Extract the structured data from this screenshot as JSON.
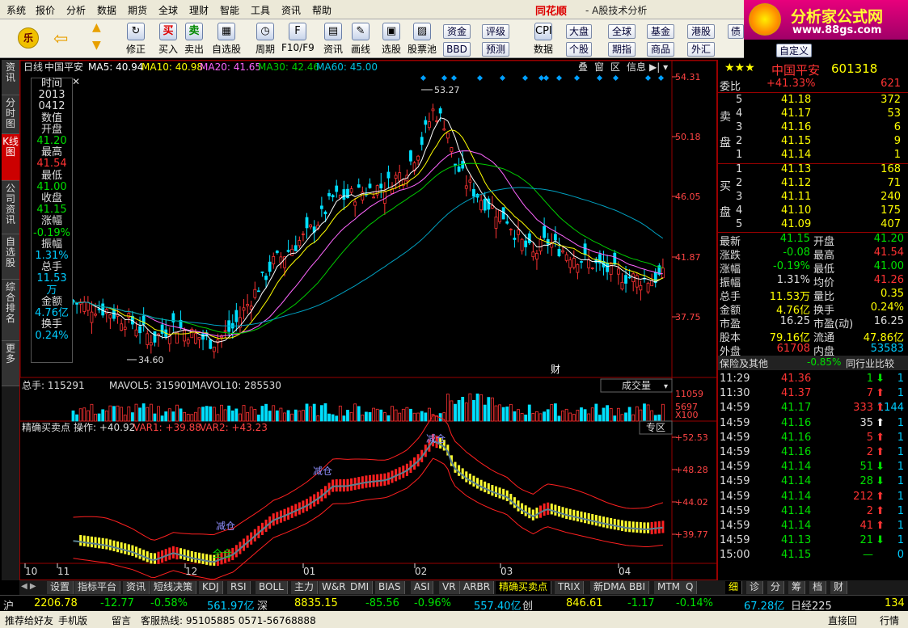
{
  "menu": [
    "系统",
    "报价",
    "分析",
    "数据",
    "期货",
    "全球",
    "理财",
    "智能",
    "工具",
    "资讯",
    "帮助"
  ],
  "brand": "同花顺",
  "window_title": "- A股技术分析",
  "logo": {
    "text": "分析家公式网",
    "url": "www.88gs.com"
  },
  "toolbar": {
    "items": [
      "修正",
      "买入",
      "卖出",
      "自选股",
      "周期",
      "F10/F9",
      "资讯",
      "画线",
      "选股",
      "股票池",
      "数据"
    ],
    "small": [
      "资金",
      "评级",
      "BBD",
      "预测",
      "大盘",
      "全球",
      "基金",
      "港股",
      "债",
      "个股",
      "期指",
      "商品",
      "外汇",
      "自定义"
    ]
  },
  "left_tabs": [
    "资讯",
    "分时图",
    "K线图",
    "公司资讯",
    "自选股",
    "综合排名",
    "更多"
  ],
  "kline": {
    "label": "日线",
    "stock": "中国平安",
    "ma5": "MA5: 40.94",
    "ma10": "MA10: 40.98",
    "ma20": "MA20: 41.65",
    "ma30": "MA30: 42.46",
    "ma60": "MA60: 45.00",
    "tools": [
      "叠",
      "窗",
      "区",
      "信息"
    ],
    "price_ticks": [
      "54.31",
      "50.18",
      "46.05",
      "41.87",
      "37.75"
    ],
    "high_label": "53.27",
    "low_label": "34.60",
    "cai_label": "财"
  },
  "infobox": [
    [
      "时间",
      "w"
    ],
    [
      "2013",
      "w"
    ],
    [
      "0412",
      "w"
    ],
    [
      "数值",
      "w"
    ],
    [
      "开盘",
      "w"
    ],
    [
      "41.20",
      "g"
    ],
    [
      "最高",
      "w"
    ],
    [
      "41.54",
      "r"
    ],
    [
      "最低",
      "w"
    ],
    [
      "41.00",
      "g"
    ],
    [
      "收盘",
      "w"
    ],
    [
      "41.15",
      "g"
    ],
    [
      "涨幅",
      "w"
    ],
    [
      "-0.19%",
      "g"
    ],
    [
      "振幅",
      "w"
    ],
    [
      "1.31%",
      "c"
    ],
    [
      "总手",
      "w"
    ],
    [
      "11.53万",
      "c"
    ],
    [
      "金额",
      "w"
    ],
    [
      "4.76亿",
      "c"
    ],
    [
      "换手",
      "w"
    ],
    [
      "0.24%",
      "c"
    ]
  ],
  "volume": {
    "title": "总手: 115291",
    "mavol5": "MAVOL5: 315901",
    "mavol10": "MAVOL10: 285530",
    "selector": "成交量",
    "ticks": [
      "11059",
      "5697",
      "X100"
    ]
  },
  "indicator": {
    "title": "精确买卖点",
    "op": "操作: +40.92",
    "var1": "VAR1: +39.88",
    "var2": "VAR2: +43.23",
    "zone": "专区",
    "ticks": [
      "+52.53",
      "+48.28",
      "+44.02",
      "+39.77"
    ],
    "labels": [
      "减仓",
      "减仓",
      "减仓",
      "全仓"
    ]
  },
  "xaxis": [
    "10",
    "11",
    "12",
    "01",
    "02",
    "03",
    "04"
  ],
  "quote": {
    "name": "中国平安",
    "code": "601318",
    "weibi_label": "委比",
    "weibi": "+41.33%",
    "weicha": "621",
    "sell": [
      [
        "5",
        "41.18",
        "372"
      ],
      [
        "4",
        "41.17",
        "53"
      ],
      [
        "3",
        "41.16",
        "6"
      ],
      [
        "2",
        "41.15",
        "9"
      ],
      [
        "1",
        "41.14",
        "1"
      ]
    ],
    "buy": [
      [
        "1",
        "41.13",
        "168"
      ],
      [
        "2",
        "41.12",
        "71"
      ],
      [
        "3",
        "41.11",
        "240"
      ],
      [
        "4",
        "41.10",
        "175"
      ],
      [
        "5",
        "41.09",
        "407"
      ]
    ],
    "sell_label": [
      "卖",
      "盘"
    ],
    "buy_label": [
      "买",
      "盘"
    ],
    "stats": [
      [
        "最新",
        "41.15",
        "g",
        "开盘",
        "41.20",
        "g"
      ],
      [
        "涨跌",
        "-0.08",
        "g",
        "最高",
        "41.54",
        "r"
      ],
      [
        "涨幅",
        "-0.19%",
        "g",
        "最低",
        "41.00",
        "g"
      ],
      [
        "振幅",
        "1.31%",
        "w",
        "均价",
        "41.26",
        "r"
      ],
      [
        "总手",
        "11.53万",
        "y",
        "量比",
        "0.35",
        "y"
      ],
      [
        "金额",
        "4.76亿",
        "y",
        "换手",
        "0.24%",
        "y"
      ],
      [
        "市盈",
        "16.25",
        "w",
        "市盈(动)",
        "16.25",
        "w"
      ],
      [
        "股本",
        "79.16亿",
        "y",
        "流通",
        "47.86亿",
        "y"
      ],
      [
        "外盘",
        "61708",
        "r",
        "内盘",
        "53583",
        "c"
      ]
    ],
    "sector": "保险及其他",
    "sector_chg": "-0.85%",
    "peer": "同行业比较",
    "ticks": [
      [
        "11:29",
        "41.36",
        "r",
        "1",
        "g",
        "1"
      ],
      [
        "11:30",
        "41.37",
        "r",
        "7",
        "r",
        "1"
      ],
      [
        "14:59",
        "41.17",
        "g",
        "333",
        "r",
        "1144"
      ],
      [
        "14:59",
        "41.16",
        "g",
        "35",
        "w",
        "1"
      ],
      [
        "14:59",
        "41.16",
        "g",
        "5",
        "r",
        "1"
      ],
      [
        "14:59",
        "41.16",
        "g",
        "2",
        "r",
        "1"
      ],
      [
        "14:59",
        "41.14",
        "g",
        "51",
        "g",
        "1"
      ],
      [
        "14:59",
        "41.14",
        "g",
        "28",
        "g",
        "1"
      ],
      [
        "14:59",
        "41.14",
        "g",
        "212",
        "r",
        "1"
      ],
      [
        "14:59",
        "41.14",
        "g",
        "2",
        "r",
        "1"
      ],
      [
        "14:59",
        "41.14",
        "g",
        "41",
        "r",
        "1"
      ],
      [
        "14:59",
        "41.13",
        "g",
        "21",
        "g",
        "1"
      ],
      [
        "15:00",
        "41.15",
        "g",
        "—",
        "g",
        "0"
      ]
    ]
  },
  "bottom_tabs": [
    "设置",
    "指标平台",
    "资讯",
    "短线决策",
    "KDJ",
    "RSI",
    "BOLL",
    "主力",
    "W&R",
    "DMI",
    "BIAS",
    "ASI",
    "VR",
    "ARBR",
    "精确买卖点",
    "TRIX",
    "新DMA",
    "BBI",
    "MTM",
    "Q"
  ],
  "right_tabs": [
    "细",
    "诊",
    "分",
    "筹",
    "档",
    "财"
  ],
  "index": {
    "sh_label": "沪",
    "sh": "2206.78",
    "sh_chg": "-12.77",
    "sh_pct": "-0.58%",
    "sh_amt": "561.97亿",
    "sz_label": "深",
    "sz": "8835.15",
    "sz_chg": "-85.56",
    "sz_pct": "-0.96%",
    "sz_amt": "557.40亿",
    "cy_label": "创",
    "cy": "846.61",
    "cy_chg": "-1.17",
    "cy_pct": "-0.14%",
    "cy_amt": "67.28亿",
    "nk_label": "日经225",
    "nk": "134"
  },
  "status": {
    "left": "推荐给好友",
    "mobile": "手机版",
    "msg": "留言",
    "hotline": "客服热线: 95105885 0571-56768888",
    "direct": "直接回",
    "trade": "行情"
  },
  "colors": {
    "up": "#ff3333",
    "down": "#00e000",
    "ma5": "#ffffff",
    "ma10": "#ffff00",
    "ma20": "#ff66ff",
    "ma30": "#00cc00",
    "ma60": "#00a0c0"
  }
}
